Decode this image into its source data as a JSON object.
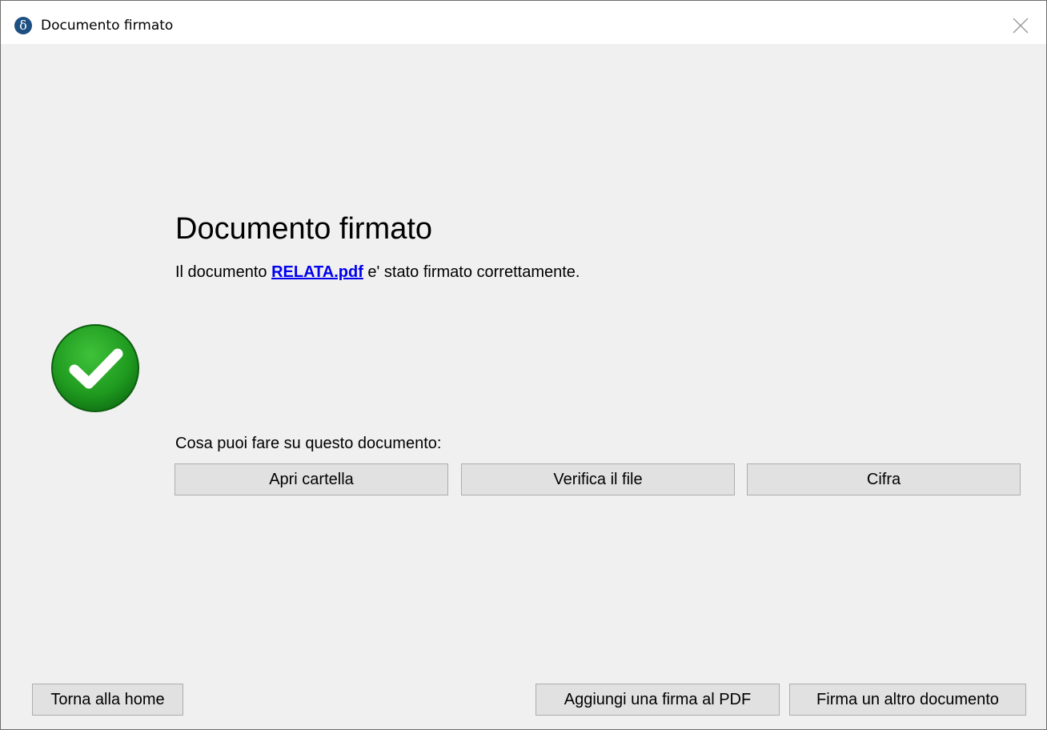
{
  "window": {
    "title": "Documento firmato",
    "app_icon_glyph": "δ"
  },
  "main": {
    "heading": "Documento firmato",
    "message_prefix": "Il documento ",
    "file_name": "RELATA.pdf",
    "message_suffix": " e' stato firmato correttamente.",
    "status_icon": "check-circle-icon",
    "actions_label": "Cosa puoi fare su questo documento:",
    "actions": [
      {
        "label": "Apri cartella"
      },
      {
        "label": "Verifica il file"
      },
      {
        "label": "Cifra"
      }
    ]
  },
  "footer": {
    "home_label": "Torna alla home",
    "add_signature_label": "Aggiungi una firma al PDF",
    "sign_another_label": "Firma un altro documento"
  },
  "colors": {
    "success_green": "#1f9a1f",
    "link_blue": "#0000ee",
    "button_face": "#e1e1e1",
    "window_bg": "#f0f0f0"
  }
}
